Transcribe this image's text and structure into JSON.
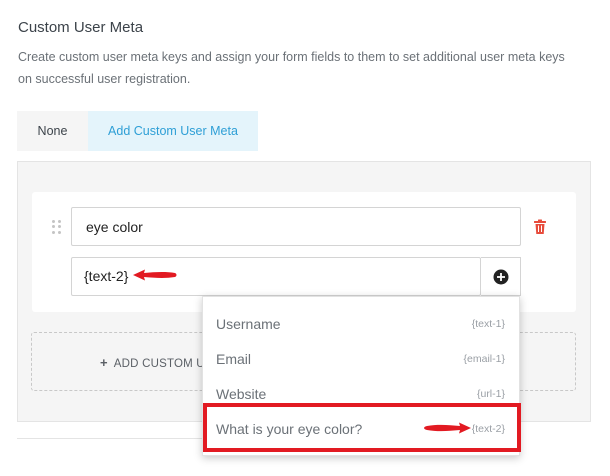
{
  "section": {
    "title": "Custom User Meta",
    "description": "Create custom user meta keys and assign your form fields to them to set additional user meta keys on successful user registration."
  },
  "tabs": [
    {
      "label": "None",
      "active": false
    },
    {
      "label": "Add Custom User Meta",
      "active": true
    }
  ],
  "meta_row": {
    "key_value": "eye color",
    "value_value": "{text-2}"
  },
  "add_row": {
    "label": "ADD CUSTOM U"
  },
  "dropdown": {
    "items": [
      {
        "label": "Username",
        "tag": "{text-1}"
      },
      {
        "label": "Email",
        "tag": "{email-1}"
      },
      {
        "label": "Website",
        "tag": "{url-1}"
      },
      {
        "label": "What is your eye color?",
        "tag": "{text-2}"
      }
    ]
  },
  "colors": {
    "accent": "#2e9fd6",
    "active_tab_bg": "#e4f4fb",
    "delete": "#e74c3c",
    "annotation_red": "#e21a22"
  },
  "icons": [
    "drag-handle-icon",
    "trash-icon",
    "plus-circle-icon",
    "plus-icon",
    "annotation-arrow-icon"
  ]
}
